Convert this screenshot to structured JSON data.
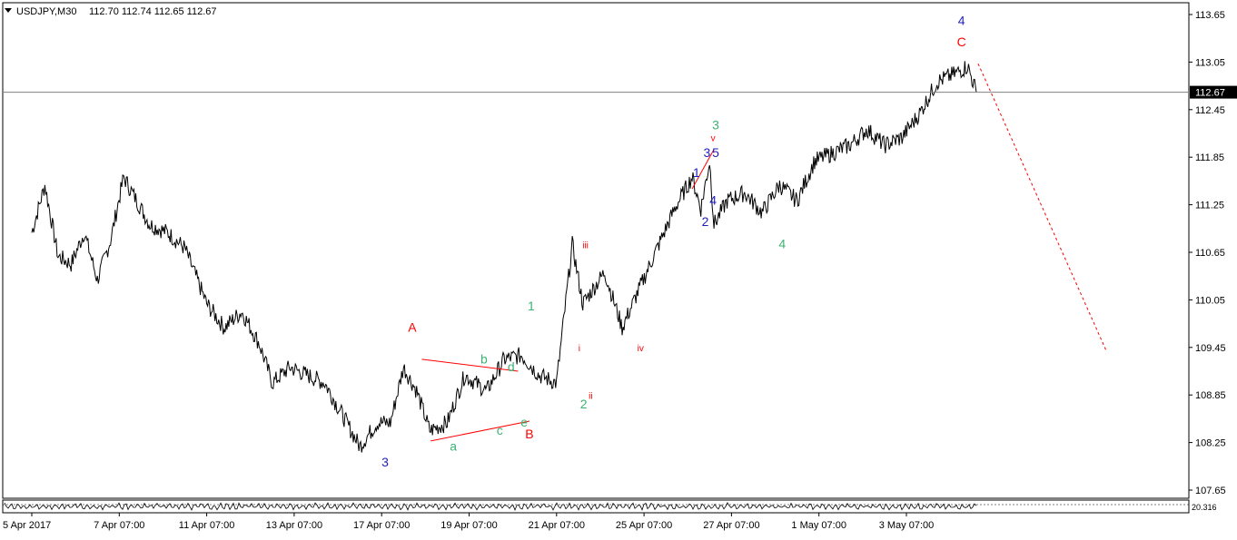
{
  "window": {
    "symbol_timeframe": "USDJPY,M30",
    "ohlc": "112.70 112.74 112.65 112.67"
  },
  "price_axis": {
    "labels": [
      "113.65",
      "113.05",
      "112.45",
      "111.85",
      "111.25",
      "110.65",
      "110.05",
      "109.45",
      "108.85",
      "108.25",
      "107.65"
    ],
    "current_price_label": "112.67"
  },
  "time_axis": {
    "labels": [
      "5 Apr 2017",
      "7 Apr 07:00",
      "11 Apr 07:00",
      "13 Apr 07:00",
      "17 Apr 07:00",
      "19 Apr 07:00",
      "21 Apr 07:00",
      "25 Apr 07:00",
      "27 Apr 07:00",
      "1 May 07:00",
      "3 May 07:00"
    ]
  },
  "indicator_pane": {
    "level_label": "20.316"
  },
  "colors": {
    "price_line": "#000000",
    "wave_red": "#ff0000",
    "wave_green": "#3cb371",
    "wave_blue": "#1f1fbf",
    "grid": "#808080"
  },
  "chart_data": {
    "type": "line",
    "title": "USDJPY,M30",
    "ylim": [
      107.45,
      113.85
    ],
    "x_categories": [
      "5 Apr 2017",
      "7 Apr 07:00",
      "11 Apr 07:00",
      "13 Apr 07:00",
      "17 Apr 07:00",
      "19 Apr 07:00",
      "21 Apr 07:00",
      "25 Apr 07:00",
      "27 Apr 07:00",
      "1 May 07:00",
      "3 May 07:00"
    ],
    "series": [
      {
        "values": [
          [
            0,
            110.9
          ],
          [
            0.15,
            111.5
          ],
          [
            0.3,
            110.6
          ],
          [
            0.45,
            110.5
          ],
          [
            0.6,
            110.9
          ],
          [
            0.75,
            110.3
          ],
          [
            0.9,
            110.8
          ],
          [
            1.05,
            111.6
          ],
          [
            1.2,
            111.3
          ],
          [
            1.35,
            111.0
          ],
          [
            1.55,
            110.9
          ],
          [
            1.75,
            110.7
          ],
          [
            2.0,
            110.0
          ],
          [
            2.2,
            109.7
          ],
          [
            2.4,
            109.9
          ],
          [
            2.6,
            109.5
          ],
          [
            2.75,
            109.0
          ],
          [
            2.95,
            109.2
          ],
          [
            3.15,
            109.1
          ],
          [
            3.35,
            109.0
          ],
          [
            3.55,
            108.6
          ],
          [
            3.75,
            108.2
          ],
          [
            3.95,
            108.5
          ],
          [
            4.1,
            108.5
          ],
          [
            4.25,
            109.2
          ],
          [
            4.4,
            108.9
          ],
          [
            4.55,
            108.4
          ],
          [
            4.75,
            108.5
          ],
          [
            4.95,
            109.1
          ],
          [
            5.2,
            108.9
          ],
          [
            5.4,
            109.3
          ],
          [
            5.6,
            109.35
          ],
          [
            5.8,
            109.1
          ],
          [
            6.0,
            109.0
          ],
          [
            6.18,
            110.75
          ],
          [
            6.3,
            110.0
          ],
          [
            6.55,
            110.4
          ],
          [
            6.75,
            109.7
          ],
          [
            6.95,
            110.2
          ],
          [
            7.15,
            110.7
          ],
          [
            7.35,
            111.2
          ],
          [
            7.55,
            111.6
          ],
          [
            7.65,
            111.2
          ],
          [
            7.75,
            111.8
          ],
          [
            7.8,
            111.0
          ],
          [
            7.95,
            111.3
          ],
          [
            8.15,
            111.4
          ],
          [
            8.35,
            111.15
          ],
          [
            8.55,
            111.5
          ],
          [
            8.75,
            111.3
          ],
          [
            8.95,
            111.8
          ],
          [
            9.15,
            111.9
          ],
          [
            9.35,
            112.0
          ],
          [
            9.55,
            112.2
          ],
          [
            9.75,
            112.0
          ],
          [
            9.95,
            112.1
          ],
          [
            10.15,
            112.4
          ],
          [
            10.35,
            112.8
          ],
          [
            10.55,
            112.9
          ],
          [
            10.7,
            113.0
          ],
          [
            10.8,
            112.67
          ]
        ]
      }
    ],
    "wave_labels": [
      {
        "text": "A",
        "x": 4.35,
        "y": 109.65,
        "color": "red"
      },
      {
        "text": "B",
        "x": 5.69,
        "y": 108.3,
        "color": "red"
      },
      {
        "text": "C",
        "x": 10.63,
        "y": 113.25,
        "color": "red"
      },
      {
        "text": "a",
        "x": 4.82,
        "y": 108.15,
        "color": "green"
      },
      {
        "text": "b",
        "x": 5.17,
        "y": 109.25,
        "color": "green"
      },
      {
        "text": "c",
        "x": 5.35,
        "y": 108.35,
        "color": "green"
      },
      {
        "text": "d",
        "x": 5.48,
        "y": 109.15,
        "color": "green"
      },
      {
        "text": "e",
        "x": 5.63,
        "y": 108.45,
        "color": "green"
      },
      {
        "text": "1",
        "x": 5.71,
        "y": 109.92,
        "color": "green"
      },
      {
        "text": "2",
        "x": 6.31,
        "y": 108.68,
        "color": "green"
      },
      {
        "text": "3",
        "x": 7.82,
        "y": 112.2,
        "color": "green"
      },
      {
        "text": "4",
        "x": 8.58,
        "y": 110.7,
        "color": "green"
      },
      {
        "text": "3",
        "x": 4.04,
        "y": 107.95,
        "color": "blue"
      },
      {
        "text": "4",
        "x": 10.63,
        "y": 113.52,
        "color": "blue"
      },
      {
        "text": "1",
        "x": 7.6,
        "y": 111.6,
        "color": "blue"
      },
      {
        "text": "2",
        "x": 7.7,
        "y": 110.98,
        "color": "blue"
      },
      {
        "text": "3",
        "x": 7.72,
        "y": 111.85,
        "color": "blue"
      },
      {
        "text": "4",
        "x": 7.79,
        "y": 111.25,
        "color": "blue"
      },
      {
        "text": "5",
        "x": 7.82,
        "y": 111.85,
        "color": "blue"
      },
      {
        "text": "i",
        "x": 6.26,
        "y": 109.4,
        "color": "red"
      },
      {
        "text": "ii",
        "x": 6.39,
        "y": 108.8,
        "color": "red"
      },
      {
        "text": "iii",
        "x": 6.33,
        "y": 110.7,
        "color": "red"
      },
      {
        "text": "iv",
        "x": 6.96,
        "y": 109.4,
        "color": "red"
      },
      {
        "text": "v",
        "x": 7.79,
        "y": 112.05,
        "color": "red"
      }
    ],
    "trend_lines": [
      {
        "points": [
          [
            4.46,
            109.3
          ],
          [
            5.56,
            109.15
          ]
        ],
        "color": "red",
        "style": "solid"
      },
      {
        "points": [
          [
            4.56,
            108.27
          ],
          [
            5.69,
            108.52
          ]
        ],
        "color": "red",
        "style": "solid"
      },
      {
        "points": [
          [
            7.55,
            111.45
          ],
          [
            7.8,
            111.95
          ]
        ],
        "color": "red",
        "style": "solid"
      },
      {
        "points": [
          [
            10.82,
            113.03
          ],
          [
            12.28,
            109.42
          ]
        ],
        "color": "red",
        "style": "dashed"
      }
    ]
  }
}
